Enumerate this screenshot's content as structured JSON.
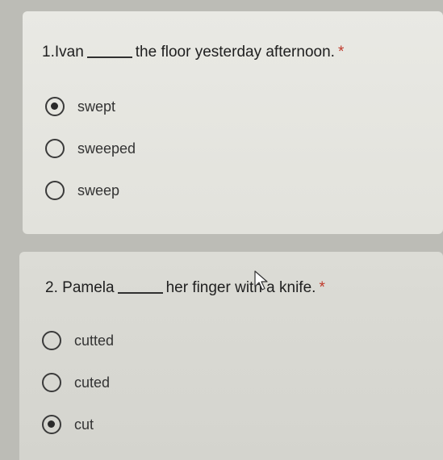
{
  "questions": [
    {
      "number": "1.",
      "prefix": "Ivan",
      "suffix": "the floor yesterday afternoon.",
      "required_mark": "*",
      "options": [
        {
          "label": "swept",
          "selected": true
        },
        {
          "label": "sweeped",
          "selected": false
        },
        {
          "label": "sweep",
          "selected": false
        }
      ]
    },
    {
      "number": "2.",
      "prefix": "Pamela",
      "suffix": "her finger with a knife.",
      "required_mark": "*",
      "options": [
        {
          "label": "cutted",
          "selected": false
        },
        {
          "label": "cuted",
          "selected": false
        },
        {
          "label": "cut",
          "selected": true
        }
      ]
    }
  ]
}
